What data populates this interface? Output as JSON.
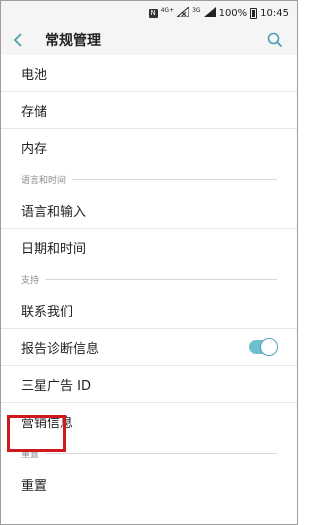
{
  "status_bar": {
    "network_badge": "N",
    "network_4g": "4G+",
    "network_3g": "3G",
    "battery_percent": "100%",
    "time": "10:45"
  },
  "appbar": {
    "back_icon": "chevron-left-icon",
    "title": "常规管理",
    "search_icon": "search-icon"
  },
  "list": {
    "item_battery": "电池",
    "item_storage": "存储",
    "item_memory": "内存",
    "header_language": "语言和时间",
    "item_language_input": "语言和输入",
    "item_date_time": "日期和时间",
    "header_support": "支持",
    "item_contact_us": "联系我们",
    "item_diagnostics": "报告诊断信息",
    "diagnostics_toggle_on": true,
    "item_ad_id": "三星广告 ID",
    "item_marketing": "营销信息",
    "header_reset": "重置",
    "item_reset": "重置"
  },
  "colors": {
    "accent": "#4a9fb5",
    "toggle_on": "#6fbfd1",
    "highlight": "#d0191d"
  }
}
